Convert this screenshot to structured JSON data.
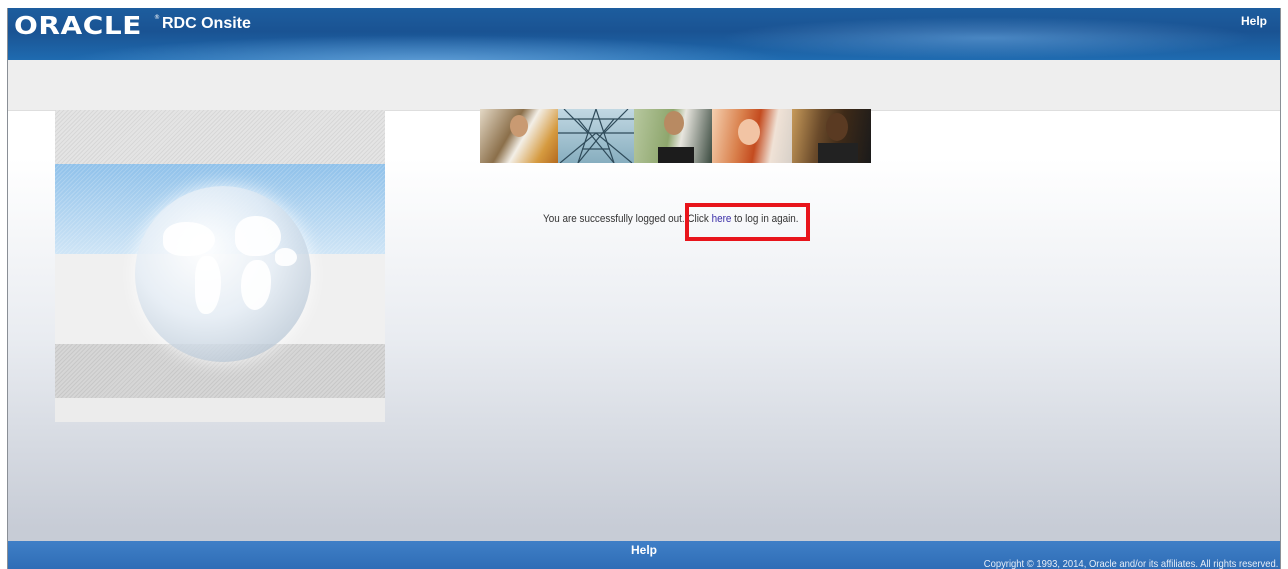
{
  "header": {
    "brand": "ORACLE",
    "brand_mark": "®",
    "product": "RDC Onsite",
    "help_label": "Help"
  },
  "main": {
    "message_prefix": "You are successfully logged out. Click ",
    "link_text": "here",
    "message_suffix": " to log in again."
  },
  "footer": {
    "help_label": "Help",
    "copyright": "Copyright © 1993, 2014, Oracle and/or its affiliates. All rights reserved."
  },
  "colors": {
    "header_blue": "#1a5393",
    "footer_blue": "#2f6db6",
    "highlight_red": "#e8141b",
    "link": "#3a2ea8"
  },
  "icons": [
    "globe-graphic"
  ]
}
